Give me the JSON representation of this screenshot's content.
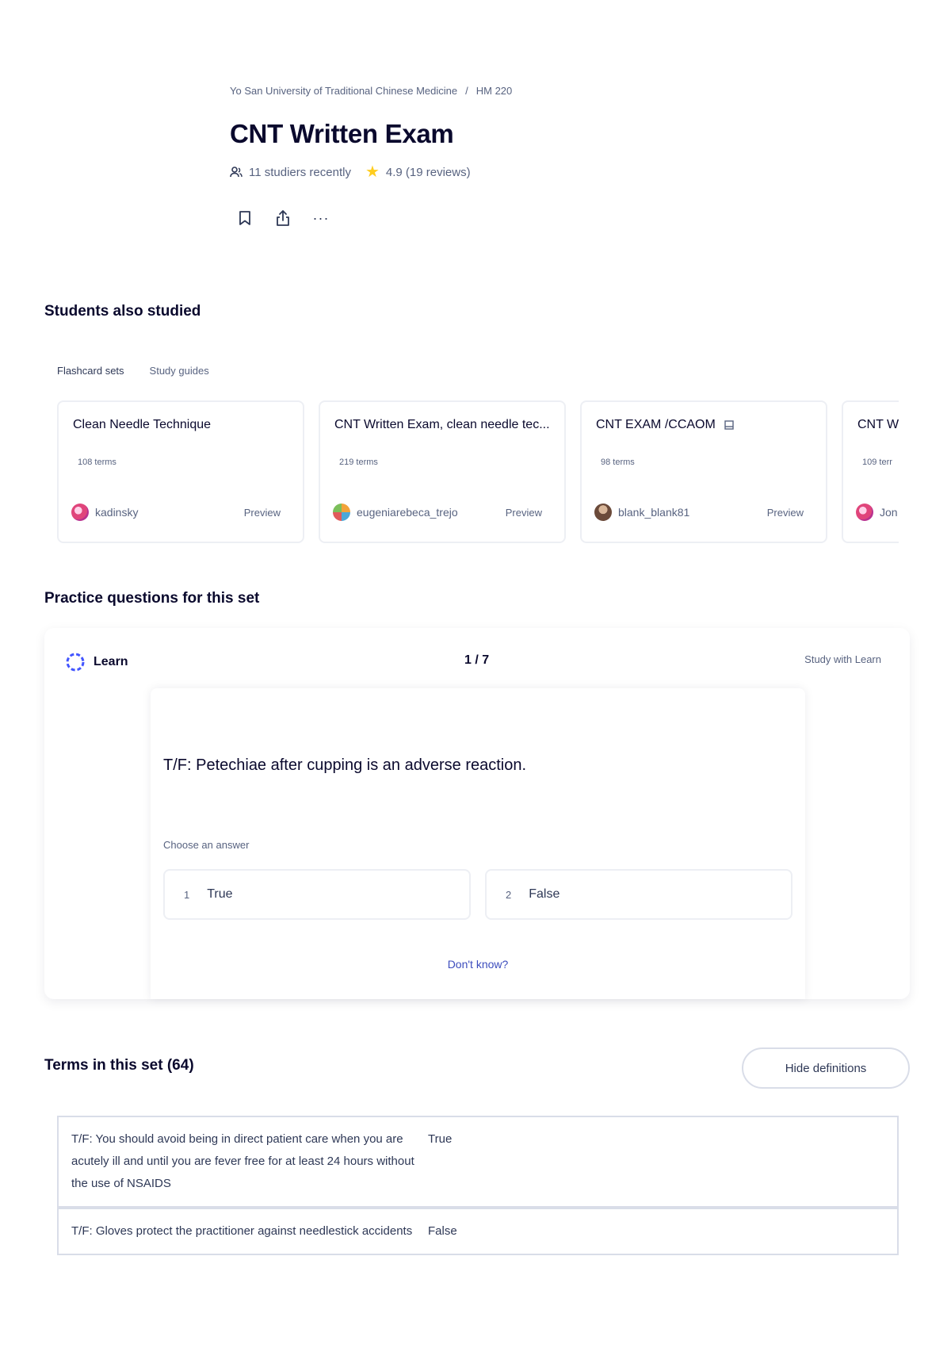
{
  "breadcrumb": {
    "school": "Yo San University of Traditional Chinese Medicine",
    "separator": "/",
    "course": "HM 220"
  },
  "title": "CNT Written Exam",
  "meta": {
    "studiers": "11 studiers recently",
    "rating": "4.9 (19 reviews)"
  },
  "actions": {
    "save_icon": "bookmark-icon",
    "share_icon": "share-icon",
    "more_label": "···"
  },
  "students_also_studied": {
    "heading": "Students also studied",
    "tabs": [
      "Flashcard sets",
      "Study guides"
    ],
    "cards": [
      {
        "title": "Clean Needle Technique",
        "terms": "108 terms",
        "user": "kadinsky",
        "preview": "Preview",
        "has_badge": false
      },
      {
        "title": "CNT Written Exam, clean needle tec...",
        "terms": "219 terms",
        "user": "eugeniarebeca_trejo",
        "preview": "Preview",
        "has_badge": false
      },
      {
        "title": "CNT EXAM /CCAOM",
        "terms": "98 terms",
        "user": "blank_blank81",
        "preview": "Preview",
        "has_badge": true
      },
      {
        "title": "CNT W",
        "terms": "109 terr",
        "user": "Jon",
        "preview": "",
        "has_badge": false
      }
    ]
  },
  "practice": {
    "heading": "Practice questions for this set",
    "learn_label": "Learn",
    "progress": "1 / 7",
    "study_link": "Study with Learn",
    "question": "T/F: Petechiae after cupping is an adverse reaction.",
    "choose_label": "Choose an answer",
    "options": [
      {
        "num": "1",
        "label": "True"
      },
      {
        "num": "2",
        "label": "False"
      }
    ],
    "dont_know": "Don't know?"
  },
  "terms": {
    "heading": "Terms in this set (64)",
    "hide_button": "Hide definitions",
    "rows": [
      {
        "term": "T/F: You should avoid being in direct patient care when you are acutely ill and until you are fever free for at least 24 hours without the use of NSAIDS",
        "definition": "True"
      },
      {
        "term": "T/F: Gloves protect the practitioner against needlestick accidents",
        "definition": "False"
      }
    ]
  },
  "colors": {
    "title": "#0a092d",
    "text": "#2e3856",
    "muted": "#586380",
    "link": "#3c4cbd",
    "star": "#ffcd1f",
    "border": "#d9dde8"
  }
}
